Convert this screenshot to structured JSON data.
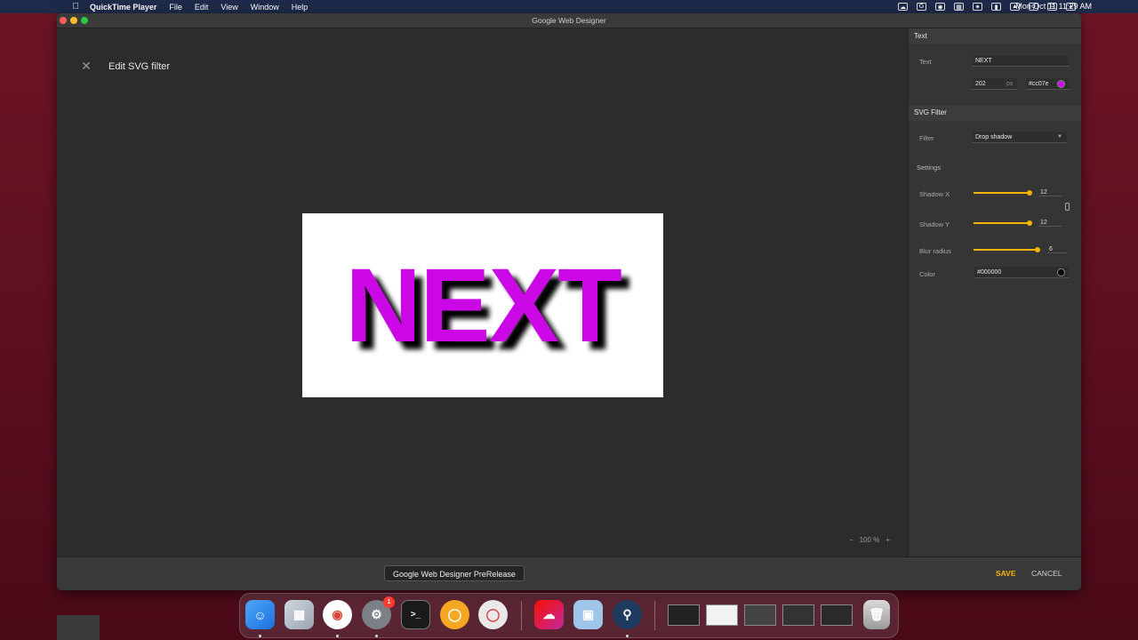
{
  "menubar": {
    "app_name": "QuickTime Player",
    "menus": [
      "File",
      "Edit",
      "View",
      "Window",
      "Help"
    ],
    "clock": "Mon Oct 11  11:29 AM"
  },
  "window": {
    "title": "Google Web Designer"
  },
  "editor": {
    "heading": "Edit SVG filter",
    "stage_text": "NEXT",
    "zoom_value": "100",
    "zoom_unit": "%"
  },
  "panel": {
    "text_section": "Text",
    "text_label": "Text",
    "text_value": "NEXT",
    "font_size": "202",
    "font_unit": "px",
    "color_value": "#cc07e",
    "svg_filter_section": "SVG Filter",
    "filter_label": "Filter",
    "filter_value": "Drop shadow",
    "settings_label": "Settings",
    "shadow_x_label": "Shadow X",
    "shadow_x_value": "12",
    "shadow_y_label": "Shadow Y",
    "shadow_y_value": "12",
    "blur_label": "Blur radius",
    "blur_value": "6",
    "shadow_color_label": "Color",
    "shadow_color_value": "#000000"
  },
  "bottombar": {
    "tooltip": "Google Web Designer PreRelease",
    "save_label": "SAVE",
    "cancel_label": "CANCEL"
  },
  "dock": {
    "badge_count": "1"
  },
  "colors": {
    "accent": "#f5b400",
    "text_fill": "#cc07e6",
    "shadow_color": "#000000"
  }
}
